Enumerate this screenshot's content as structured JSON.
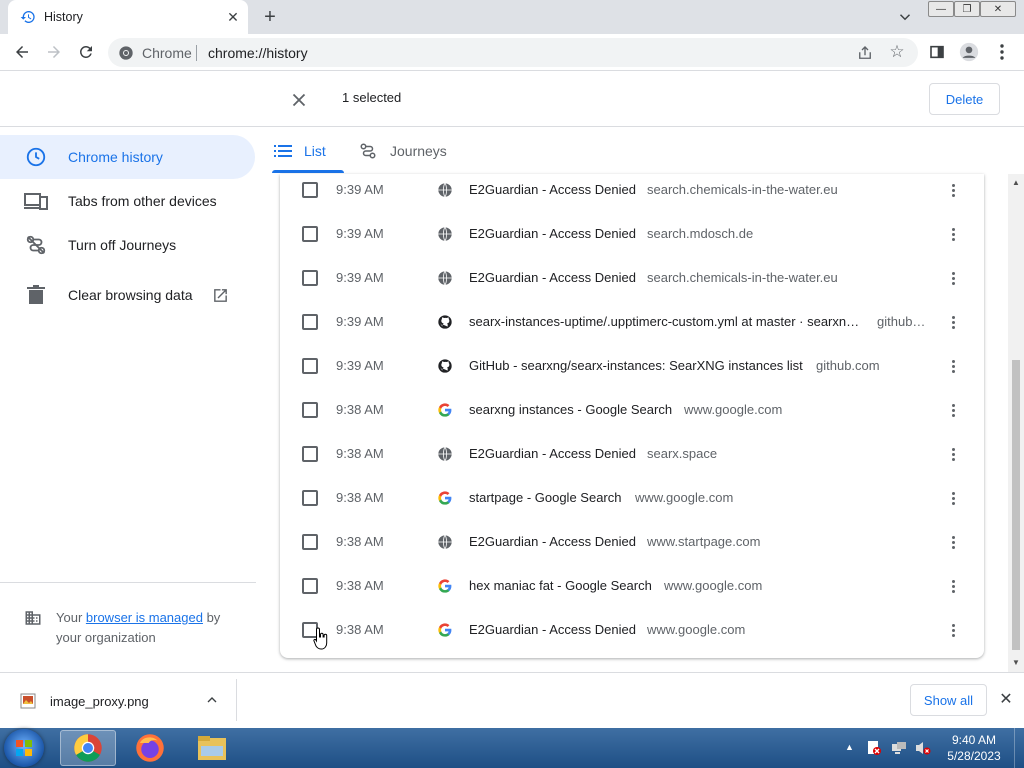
{
  "tab": {
    "title": "History",
    "close": "✕",
    "new": "+"
  },
  "omnibox": {
    "site_chip": "Chrome",
    "url": "chrome://history"
  },
  "selection": {
    "count_text": "1 selected",
    "delete_label": "Delete"
  },
  "sidebar": {
    "items": [
      {
        "label": "Chrome history",
        "icon": "clock-icon",
        "active": true
      },
      {
        "label": "Tabs from other devices",
        "icon": "devices-icon",
        "active": false
      },
      {
        "label": "Turn off Journeys",
        "icon": "journeys-off-icon",
        "active": false
      },
      {
        "label": "Clear browsing data",
        "icon": "trash-icon",
        "active": false
      }
    ],
    "managed": {
      "prefix": "Your ",
      "link": "browser is managed",
      "suffix": " by your organization"
    }
  },
  "view_tabs": [
    {
      "label": "List",
      "active": true
    },
    {
      "label": "Journeys",
      "active": false
    }
  ],
  "history": [
    {
      "time": "9:39 AM",
      "favicon": "globe-icon",
      "title": "E2Guardian - Access Denied",
      "domain": "search.chemicals-in-the-water.eu",
      "selected": false
    },
    {
      "time": "9:39 AM",
      "favicon": "globe-icon",
      "title": "E2Guardian - Access Denied",
      "domain": "search.mdosch.de",
      "selected": false
    },
    {
      "time": "9:39 AM",
      "favicon": "globe-icon",
      "title": "E2Guardian - Access Denied",
      "domain": "search.chemicals-in-the-water.eu",
      "selected": false
    },
    {
      "time": "9:39 AM",
      "favicon": "github-icon",
      "title": "searx-instances-uptime/.upptimerc-custom.yml at master · searxn…",
      "domain": "github…",
      "selected": false
    },
    {
      "time": "9:39 AM",
      "favicon": "github-icon",
      "title": "GitHub - searxng/searx-instances: SearXNG instances list",
      "domain": "github.com",
      "selected": false
    },
    {
      "time": "9:38 AM",
      "favicon": "google-icon",
      "title": "searxng instances - Google Search",
      "domain": "www.google.com",
      "selected": false
    },
    {
      "time": "9:38 AM",
      "favicon": "globe-icon",
      "title": "E2Guardian - Access Denied",
      "domain": "searx.space",
      "selected": false
    },
    {
      "time": "9:38 AM",
      "favicon": "google-icon",
      "title": "startpage - Google Search",
      "domain": "www.google.com",
      "selected": false
    },
    {
      "time": "9:38 AM",
      "favicon": "globe-icon",
      "title": "E2Guardian - Access Denied",
      "domain": "www.startpage.com",
      "selected": false
    },
    {
      "time": "9:38 AM",
      "favicon": "google-icon",
      "title": "hex maniac fat - Google Search",
      "domain": "www.google.com",
      "selected": false
    },
    {
      "time": "9:38 AM",
      "favicon": "google-icon",
      "title": "E2Guardian - Access Denied",
      "domain": "www.google.com",
      "selected": true
    }
  ],
  "downloads": {
    "file_name": "image_proxy.png",
    "show_all": "Show all"
  },
  "taskbar": {
    "time": "9:40 AM",
    "date": "5/28/2023"
  },
  "colors": {
    "accent": "#1a73e8",
    "active_bg": "#e8f0fe"
  }
}
